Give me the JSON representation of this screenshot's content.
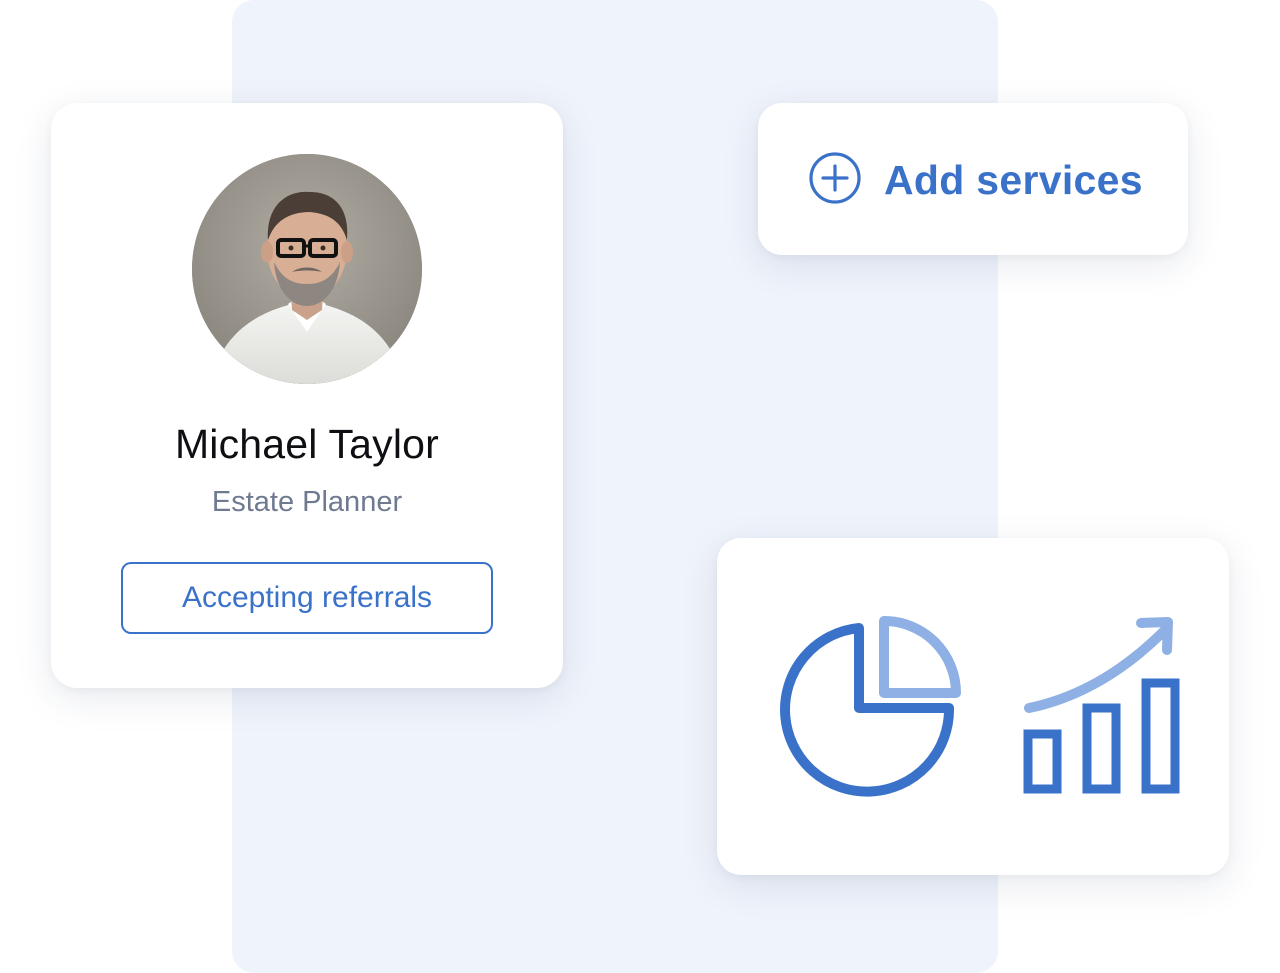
{
  "profile": {
    "name": "Michael Taylor",
    "role": "Estate Planner",
    "referral_label": "Accepting referrals"
  },
  "services": {
    "add_label": "Add services"
  },
  "icons": {
    "add": "plus-circle-icon",
    "pie": "pie-chart-icon",
    "growth": "bar-growth-icon"
  },
  "colors": {
    "accent": "#3a72c9",
    "accent_light": "#8fb0e4",
    "panel": "#eff3fb",
    "role_text": "#6f7990",
    "name_text": "#0d0f12"
  }
}
